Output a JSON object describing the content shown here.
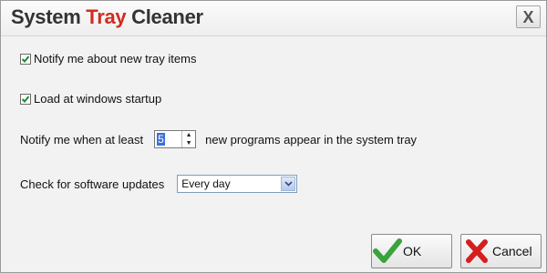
{
  "window": {
    "title_part1": "System",
    "title_part2": "Tray",
    "title_part3": "Cleaner",
    "close_label": "X",
    "accent_color": "#d22b1f"
  },
  "options": {
    "notify_new": {
      "label": "Notify me about new tray items",
      "checked": true
    },
    "load_startup": {
      "label": "Load at windows startup",
      "checked": true
    }
  },
  "threshold": {
    "label_before": "Notify me when at least",
    "value": "5",
    "label_after": "new programs appear in the system tray"
  },
  "updates": {
    "label": "Check for software updates",
    "selected": "Every day"
  },
  "buttons": {
    "ok_label": "OK",
    "cancel_label": "Cancel",
    "ok_icon": "green-check-icon",
    "cancel_icon": "red-x-icon"
  }
}
